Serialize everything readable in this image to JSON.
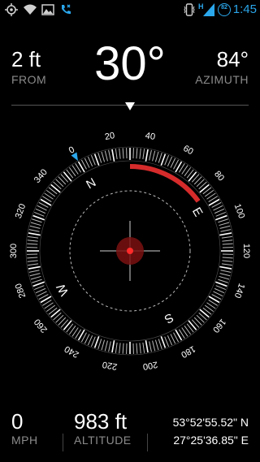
{
  "status_bar": {
    "time": "1:45",
    "battery_badge": "82",
    "network_label": "H",
    "icons": [
      "location-target-icon",
      "wifi-icon",
      "image-icon",
      "missed-call-icon",
      "vibrate-icon",
      "signal-icon",
      "battery-icon"
    ]
  },
  "header": {
    "distance_value": "2 ft",
    "distance_label": "FROM",
    "bearing_value": "30°",
    "azimuth_value": "84°",
    "azimuth_label": "AZIMUTH"
  },
  "compass": {
    "heading_deg": 30,
    "azimuth_deg": 84,
    "arc_color": "#d62b2b",
    "ticks": [
      "0",
      "20",
      "40",
      "60",
      "80",
      "100",
      "120",
      "140",
      "160",
      "180",
      "200",
      "220",
      "240",
      "260",
      "280",
      "300",
      "320",
      "340"
    ],
    "cardinals": [
      "N",
      "E",
      "S",
      "W"
    ]
  },
  "footer": {
    "speed_value": "0",
    "speed_label": "MPH",
    "altitude_value": "983 ft",
    "altitude_label": "ALTITUDE",
    "latitude": "53°52'55.52\" N",
    "longitude": "27°25'36.85\" E"
  }
}
